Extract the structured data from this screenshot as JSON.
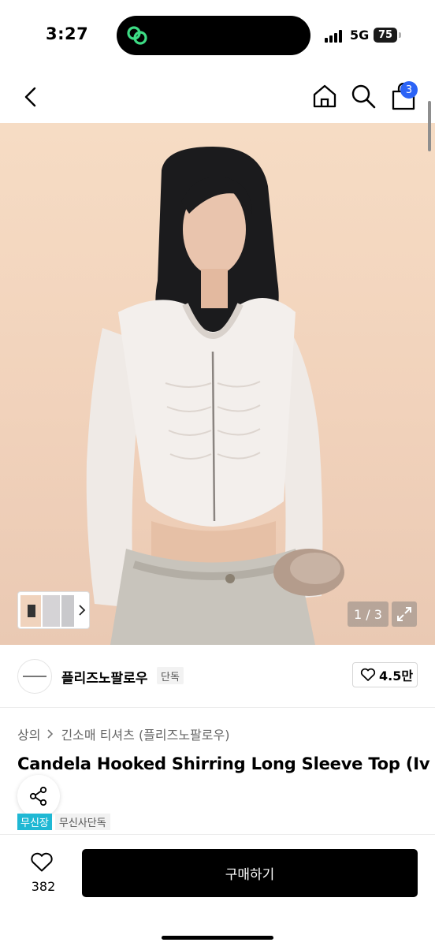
{
  "status_bar": {
    "time": "3:27",
    "network": "5G",
    "battery": "75"
  },
  "header": {
    "cart_count": "3"
  },
  "gallery": {
    "counter": "1 / 3",
    "image_count": 3
  },
  "brand": {
    "name": "플리즈노팔로우",
    "tag": "단독",
    "likes": "4.5만"
  },
  "breadcrumb": {
    "level1": "상의",
    "level2": "긴소매 티셔츠 (플리즈노팔로우)"
  },
  "product": {
    "title": "Candela Hooked Shirring Long Sleeve Top (Iv"
  },
  "tags": {
    "new": "무신장",
    "exclusive": "무신사단독"
  },
  "bottom_bar": {
    "wish_count": "382",
    "buy_label": "구매하기"
  },
  "colors": {
    "accent_badge": "#2b63f6",
    "tag_teal": "#1fb8d4",
    "buy_bg": "#000000",
    "island_icon": "#3ddc84"
  }
}
